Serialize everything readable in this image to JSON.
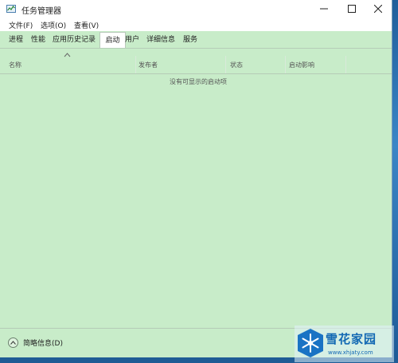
{
  "window": {
    "title": "任务管理器",
    "controls": [
      "minimize",
      "maximize",
      "close"
    ]
  },
  "menu": {
    "items": [
      "文件(F)",
      "选项(O)",
      "查看(V)"
    ]
  },
  "tabs": {
    "items": [
      "进程",
      "性能",
      "应用历史记录",
      "启动",
      "用户",
      "详细信息",
      "服务"
    ],
    "active": "启动"
  },
  "table": {
    "columns": [
      "名称",
      "发布者",
      "状态",
      "启动影响"
    ],
    "empty_message": "没有可显示的启动项"
  },
  "footer": {
    "fewer_details_label": "简略信息(D)"
  },
  "watermark": {
    "text": "雪花家园",
    "url": "www.xhjaty.com"
  },
  "colors": {
    "window_bg": "#c8ecc9",
    "titlebar_bg": "#ffffff",
    "desktop": "#2e6fa8",
    "watermark_text": "#1268b3"
  },
  "icons": {
    "app": "task-manager-icon",
    "minimize": "minimize-icon",
    "maximize": "maximize-icon",
    "close": "close-icon",
    "sort": "sort-ascending-icon",
    "fewer_details": "chevron-up-circle-icon"
  }
}
